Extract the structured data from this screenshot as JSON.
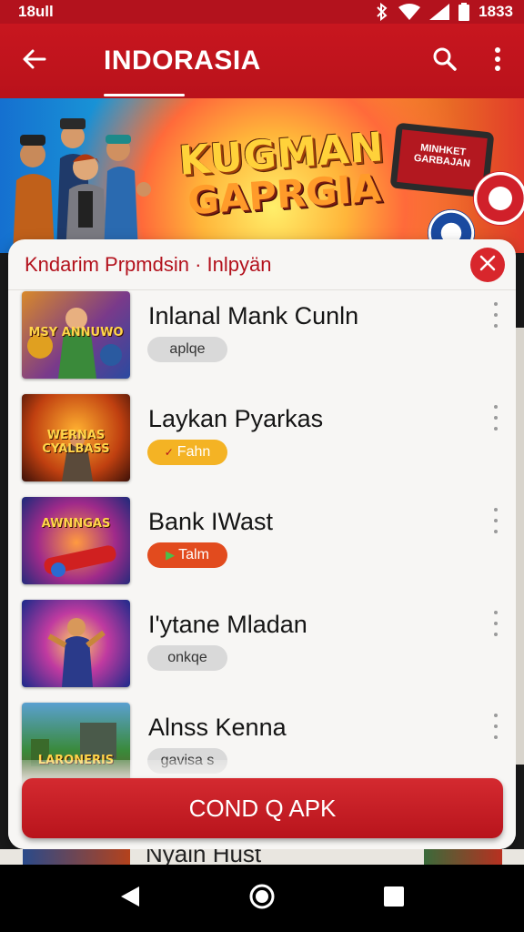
{
  "status_bar": {
    "left": "18ull",
    "time": "1833"
  },
  "app_bar": {
    "title": "INDORASIA"
  },
  "banner": {
    "line1": "KUGMAN",
    "line2": "GAPRGIA",
    "device_text": "MINHKET GARBAJAN"
  },
  "dialog": {
    "title": "Kndarim Prpmdsin · Inlpyän",
    "items": [
      {
        "name": "Inlanal Mank Cunln",
        "tag": "aplqe",
        "thumb_caption": "MSY ANNUWO",
        "pill_style": "grey"
      },
      {
        "name": "Laykan Pyarkas",
        "tag": "Fahn",
        "thumb_caption": "WERNAS CYALBASS",
        "pill_style": "yellow"
      },
      {
        "name": "Bank IWast",
        "tag": "Talm",
        "thumb_caption": "AWNNGAS",
        "pill_style": "red"
      },
      {
        "name": "I'ytane Mladan",
        "tag": "onkqe",
        "thumb_caption": "",
        "pill_style": "grey"
      },
      {
        "name": "Alnss Kenna",
        "tag": "gavisa s",
        "thumb_caption": "LARONERIS",
        "pill_style": "grey"
      }
    ],
    "cta_label": "COND Q APK"
  },
  "peek": {
    "text": "Nyain Hust"
  },
  "colors": {
    "primary": "#c8161f",
    "accent_yellow": "#f4b324",
    "accent_orange": "#e24b1e"
  }
}
